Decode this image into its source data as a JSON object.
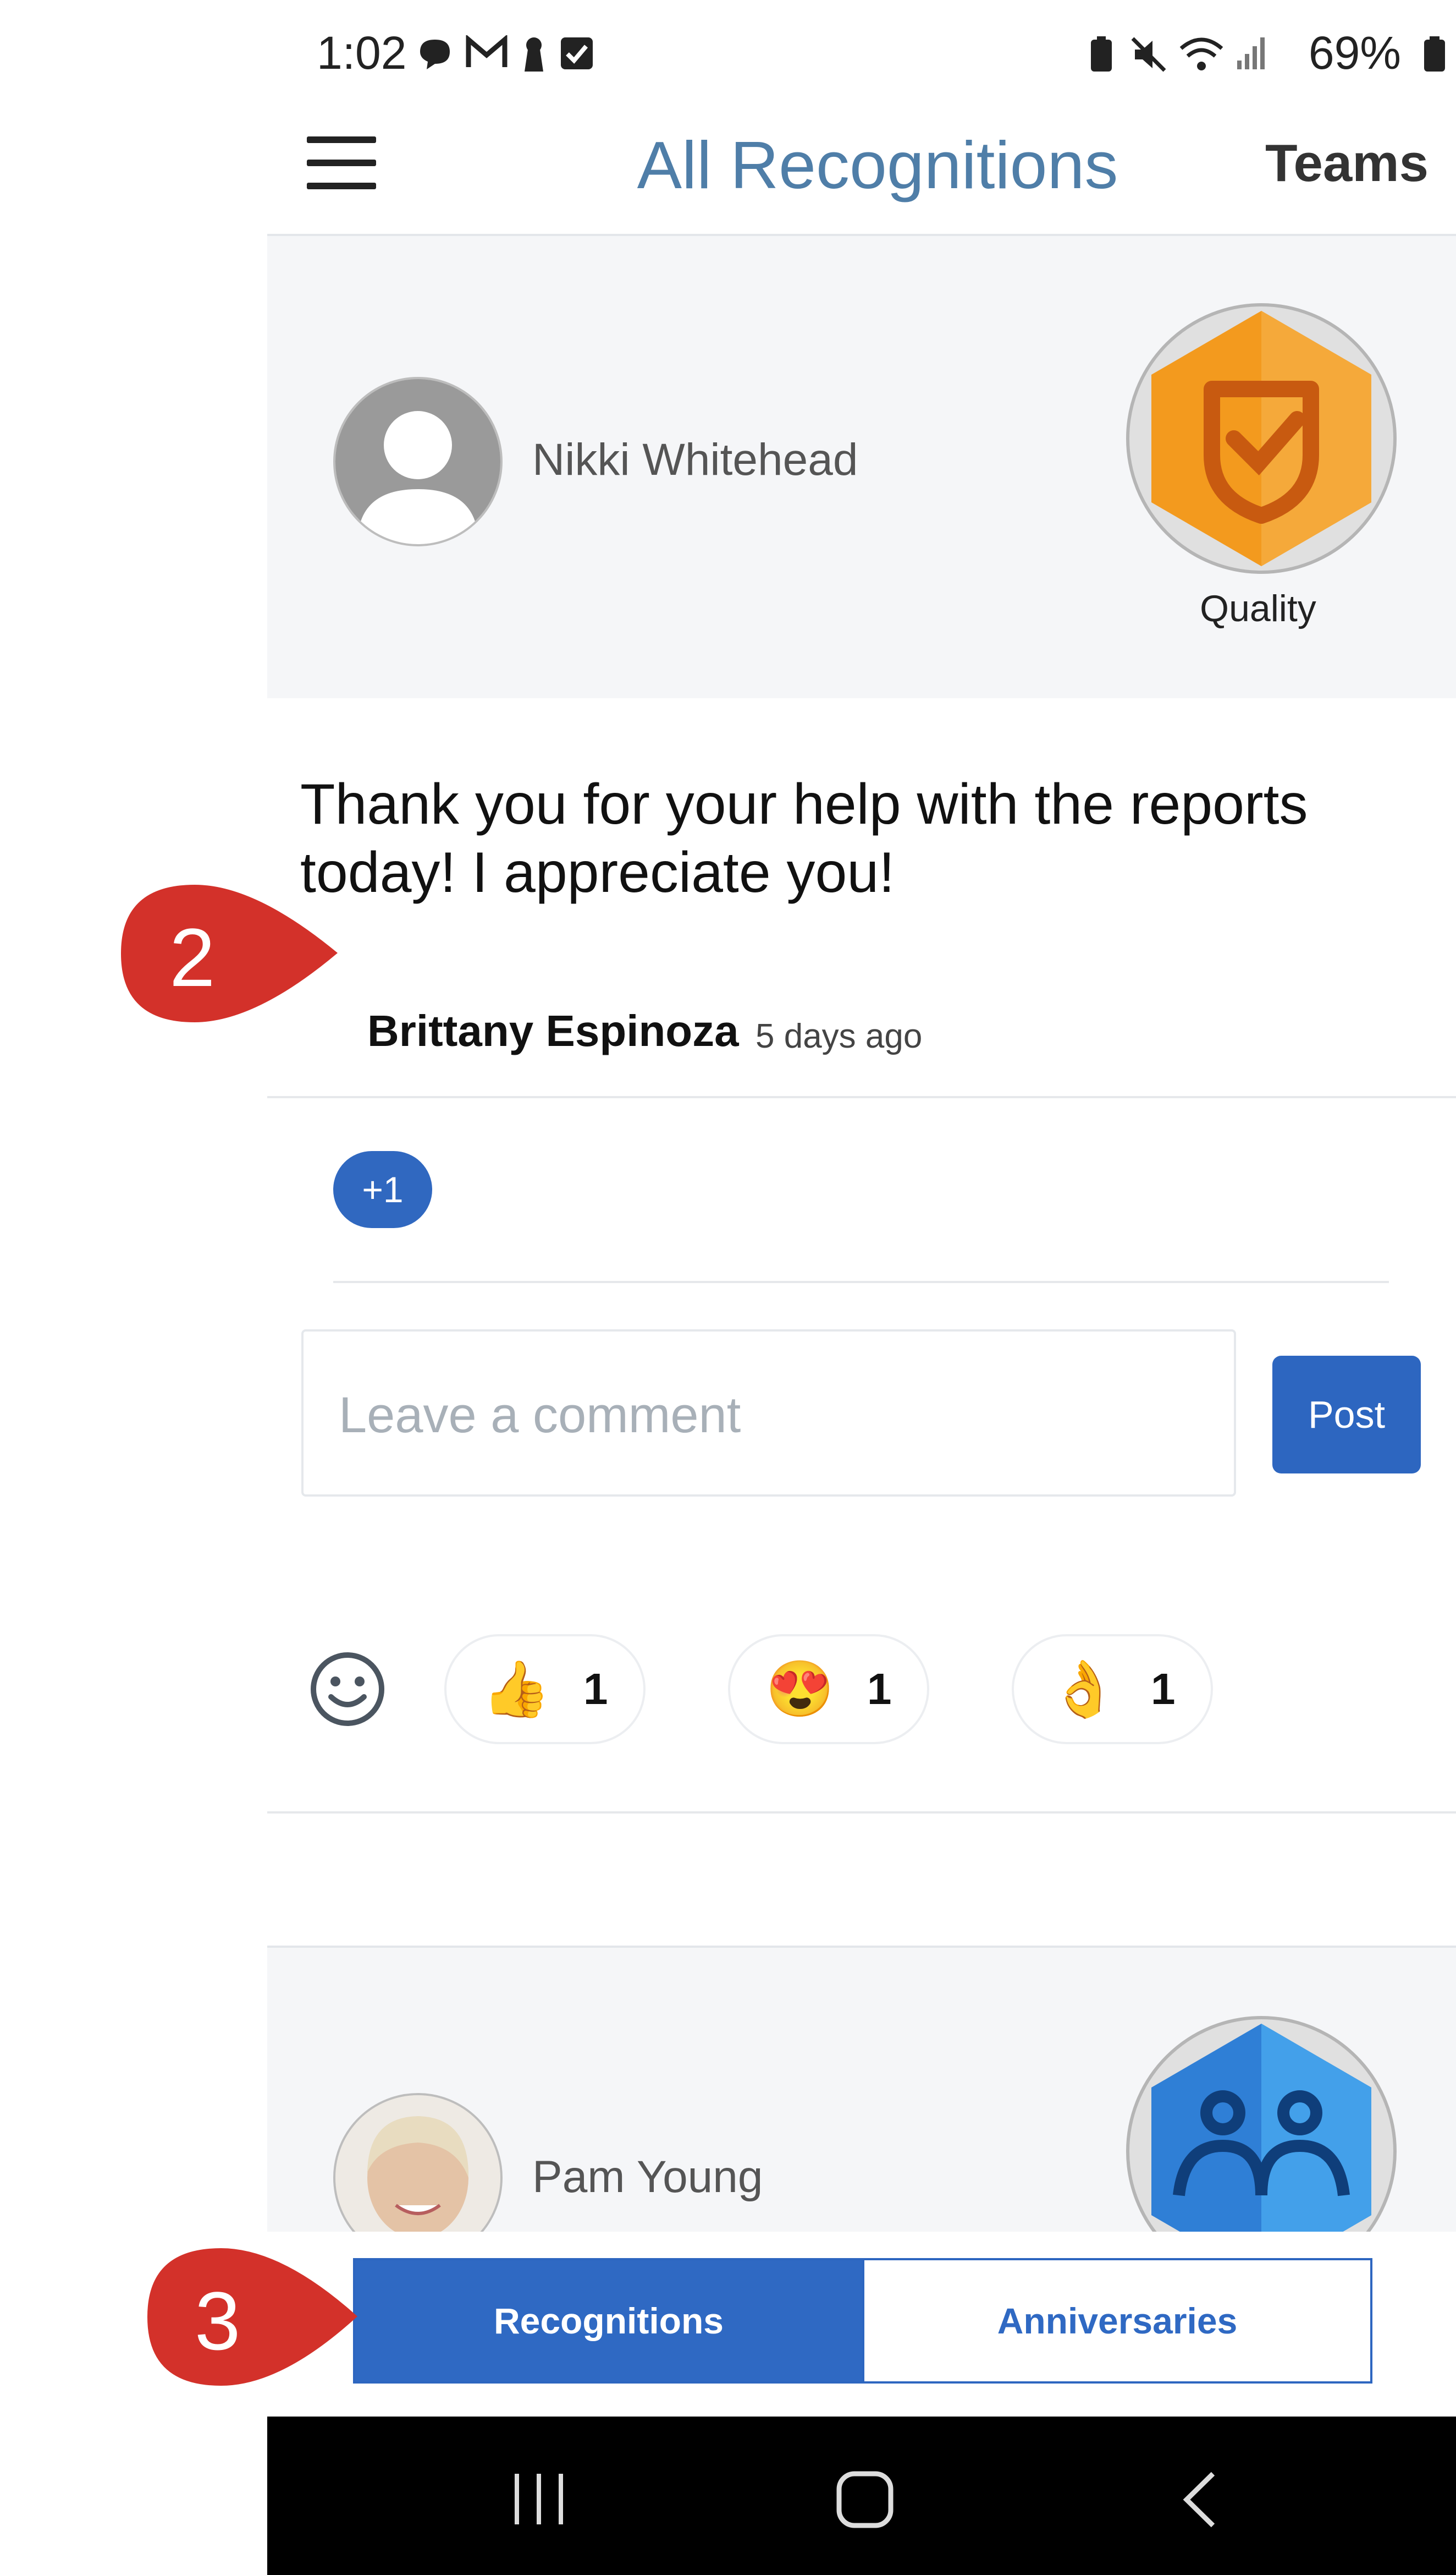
{
  "status_bar": {
    "time": "1:02",
    "battery": "69%"
  },
  "header": {
    "title": "All Recognitions",
    "teams_label": "Teams"
  },
  "recognitions": [
    {
      "recipient": "Nikki Whitehead",
      "badge_label": "Quality",
      "message": "Thank you for your help with the reports today! I appreciate you!",
      "author": "Brittany Espinoza",
      "time_ago": "5 days ago",
      "plus_label": "+1",
      "comment_placeholder": "Leave a comment",
      "post_label": "Post",
      "reactions": [
        {
          "icon": "thumbs-up",
          "emoji": "👍",
          "count": "1"
        },
        {
          "icon": "heart-eyes",
          "emoji": "😍",
          "count": "1"
        },
        {
          "icon": "ok-hand",
          "emoji": "👌",
          "count": "1"
        }
      ]
    },
    {
      "recipient": "Pam Young"
    }
  ],
  "tabs": {
    "active": "Recognitions",
    "inactive": "Anniversaries"
  },
  "callouts": {
    "first": "2",
    "second": "3"
  },
  "colors": {
    "accent": "#2f69c3",
    "title": "#4f7ea8",
    "callout": "#d3312a",
    "badge_orange": "#f39a1e",
    "badge_blue": "#2f7fd6"
  }
}
